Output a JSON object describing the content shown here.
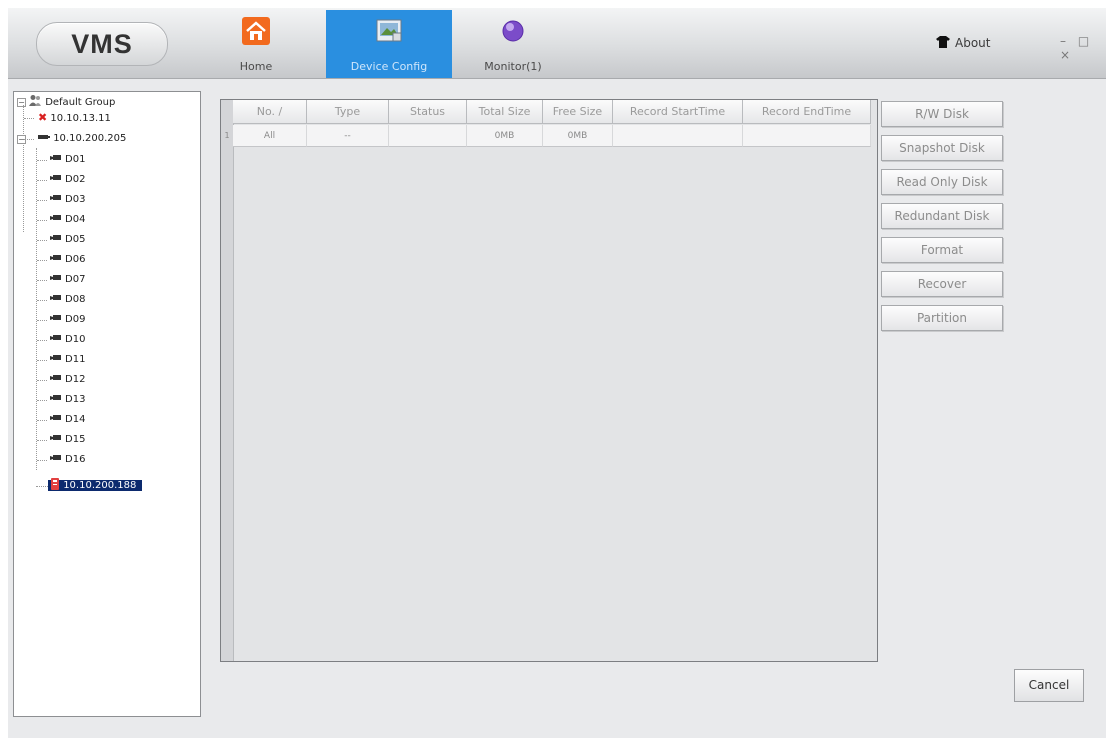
{
  "app": {
    "logo": "VMS"
  },
  "nav": {
    "tabs": [
      {
        "label": "Home",
        "icon": "home-icon"
      },
      {
        "label": "Device Config",
        "icon": "device-config-icon"
      },
      {
        "label": "Monitor(1)",
        "icon": "monitor-icon"
      }
    ],
    "active": "Device Config",
    "about": "About",
    "window_controls": "– □ ×"
  },
  "tree": {
    "root": "Default Group",
    "devices": [
      {
        "label": "10.10.13.11",
        "status": "offline",
        "icon": "red-x-icon"
      },
      {
        "label": "10.10.200.205",
        "status": "online",
        "icon": "device-icon",
        "channels": [
          "D01",
          "D02",
          "D03",
          "D04",
          "D05",
          "D06",
          "D07",
          "D08",
          "D09",
          "D10",
          "D11",
          "D12",
          "D13",
          "D14",
          "D15",
          "D16"
        ]
      },
      {
        "label": "10.10.200.188",
        "status": "selected",
        "icon": "nvr-icon"
      }
    ]
  },
  "table": {
    "columns": [
      "No. /",
      "Type",
      "Status",
      "Total Size",
      "Free Size",
      "Record StartTime",
      "Record EndTime"
    ],
    "rows": [
      {
        "num": "1",
        "cells": [
          "All",
          "--",
          "",
          "0MB",
          "0MB",
          "",
          ""
        ]
      }
    ]
  },
  "actions": [
    "R/W Disk",
    "Snapshot Disk",
    "Read Only Disk",
    "Redundant Disk",
    "Format",
    "Recover",
    "Partition"
  ],
  "cancel": "Cancel",
  "colors": {
    "active_tab": "#2a8fe0",
    "selection": "#0c2a6e",
    "offline": "#d92020"
  }
}
